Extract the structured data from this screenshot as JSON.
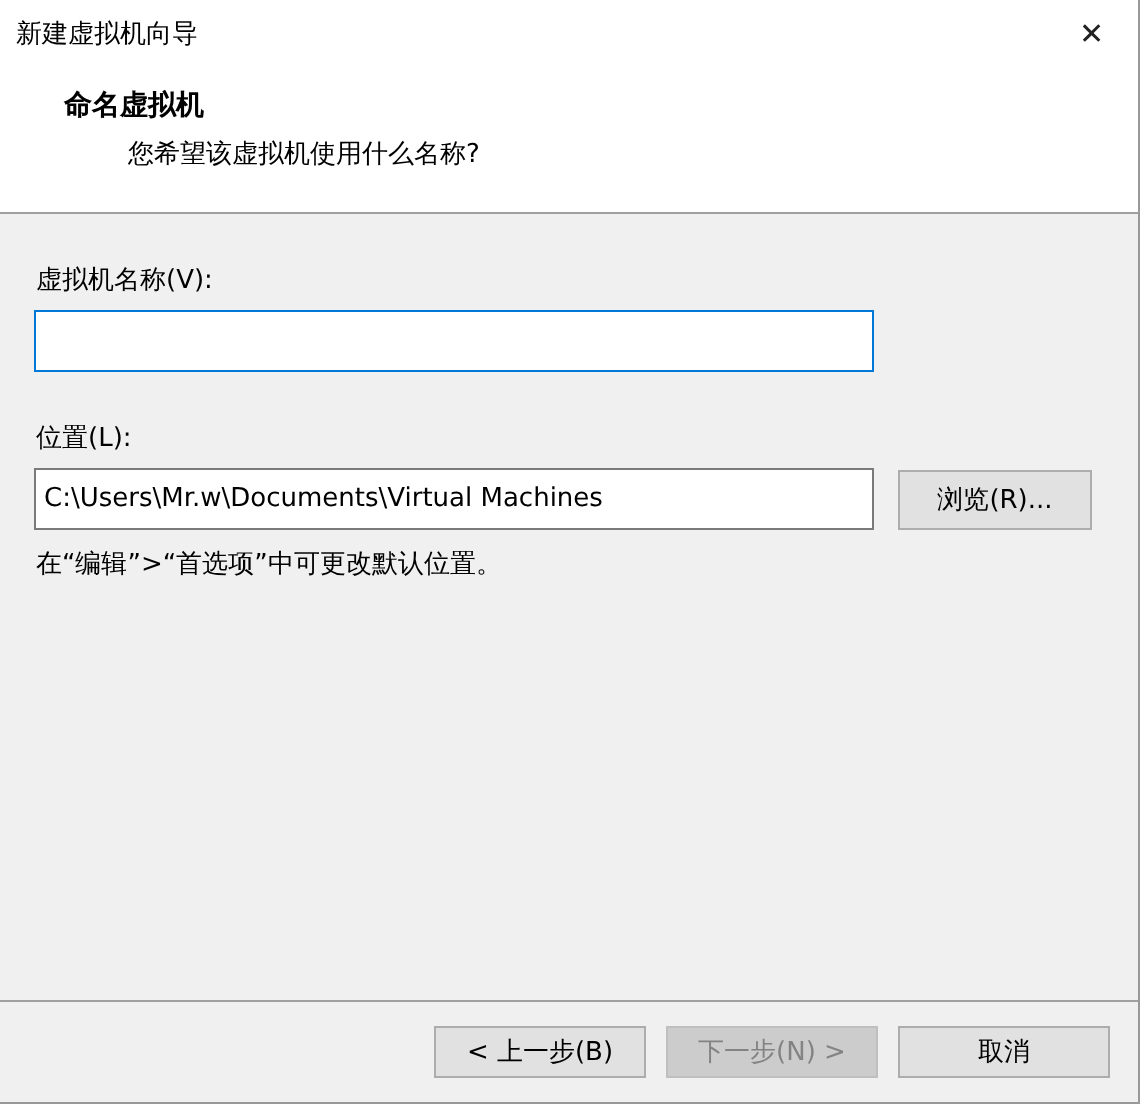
{
  "window": {
    "title": "新建虚拟机向导",
    "close": "✕"
  },
  "header": {
    "heading": "命名虚拟机",
    "subtitle": "您希望该虚拟机使用什么名称?"
  },
  "fields": [
    {
      "label": "虚拟机名称(V):",
      "focused": true
    },
    {
      "label": "位置(L):",
      "value": "C:\\Users\\Mr.w\\Documents\\Virtual Machines",
      "focused": false,
      "button": "浏览(R)..."
    }
  ],
  "note": "在“编辑”>“首选项”中可更改默认位置。",
  "buttons": [
    {
      "label": "< 上一步(B)",
      "disabled": false
    },
    {
      "label": "下一步(N) >",
      "disabled": true
    },
    {
      "label": "取消",
      "disabled": false
    }
  ]
}
